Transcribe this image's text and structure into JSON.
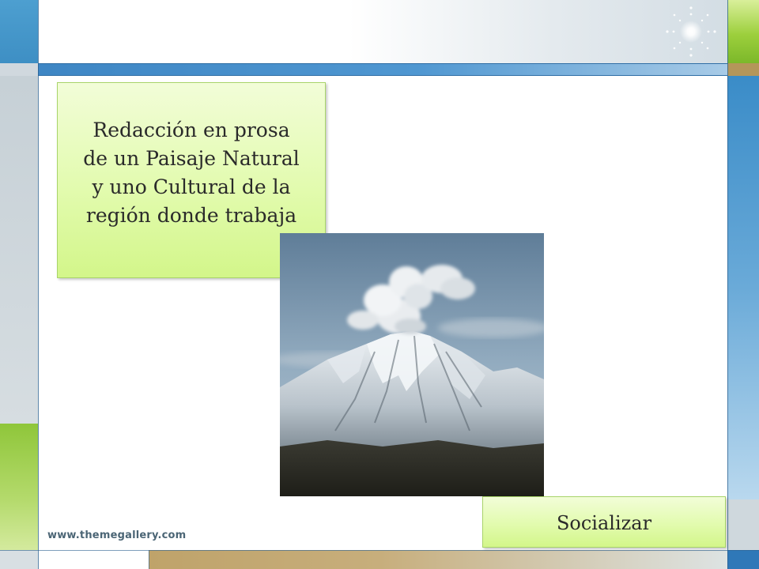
{
  "slide": {
    "title_text": "Redacción en  prosa\nde un Paisaje Natural\ny uno Cultural de la\nregión donde trabaja",
    "action_label": "Socializar",
    "footer_url": "www.themegallery.com",
    "photo_icon": "volcano-photo",
    "decoration_icon": "sparkle-icon"
  },
  "colors": {
    "box_fill": "#e2fbae",
    "box_border": "#a9d46a",
    "accent_blue": "#3e86c4",
    "accent_green": "#9ccf3c",
    "accent_tan": "#bfa36a"
  }
}
